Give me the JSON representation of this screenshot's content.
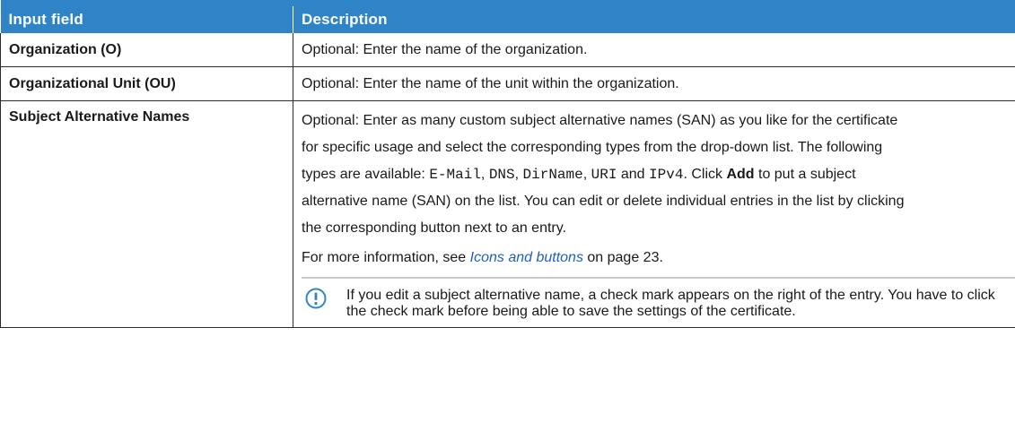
{
  "table": {
    "headers": [
      "Input field",
      "Description"
    ],
    "rows": [
      {
        "field": "Organization (O)",
        "description": "Optional: Enter the name of the organization."
      },
      {
        "field": "Organizational Unit (OU)",
        "description": "Optional: Enter the name of the unit within the organization."
      },
      {
        "field": "Subject Alternative Names",
        "line1": "Optional: Enter as many custom subject alternative names (SAN) as you like for the certificate",
        "line2": "for specific usage and select the corresponding types from the drop-down list. The following",
        "types_prefix": "types are available: ",
        "types": [
          "E-Mail",
          "DNS",
          "DirName",
          "URI",
          "IPv4"
        ],
        "sep1": ", ",
        "sep2": ", ",
        "sep3": ", ",
        "sep4": " and ",
        "click_text": ". Click ",
        "add_label": "Add",
        "after_add": " to put a subject",
        "line4": "alternative name (SAN) on the list. You can edit or delete individual entries in the list by clicking",
        "line5": "the corresponding button next to an entry.",
        "more_prefix": "For more information, see ",
        "more_link": "Icons and buttons",
        "more_suffix": " on page 23.",
        "note_text": "If you edit a subject alternative name, a check mark appears on the right of the entry. You have to click the check mark before being able to save the settings of the certificate.",
        "note_icon": "exclamation-circle-icon",
        "note_color": "#2f84c7"
      }
    ]
  },
  "colors": {
    "header_bg": "#2f84c7",
    "link": "#1f5fbf"
  }
}
